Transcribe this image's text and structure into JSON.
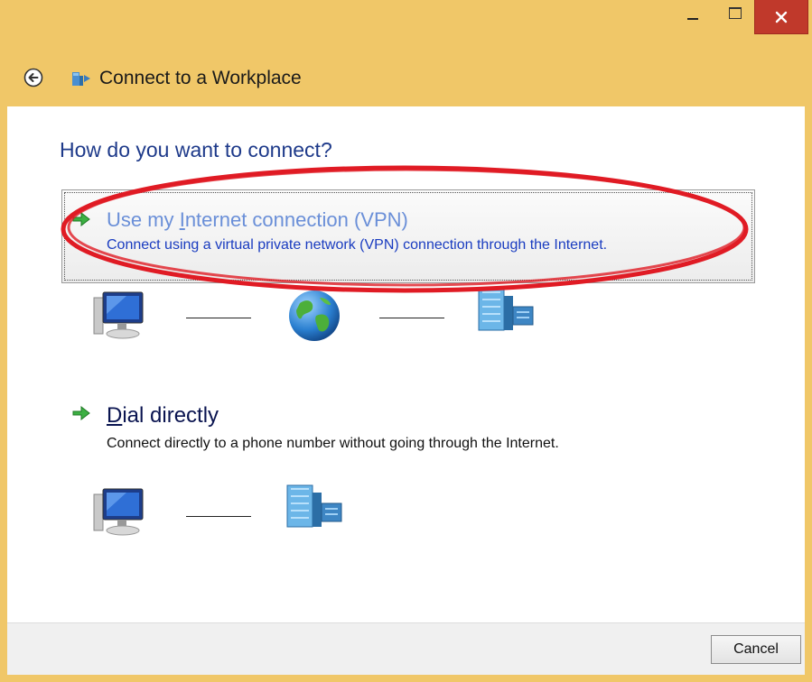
{
  "window": {
    "title": "Connect to a Workplace",
    "accent_color": "#f0c768",
    "close_color": "#c0392b"
  },
  "titlebar_icons": [
    "minimize-icon",
    "maximize-icon",
    "close-icon"
  ],
  "nav": {
    "back_icon": "back-arrow-icon",
    "app_icon": "network-workplace-icon",
    "title": "Connect to a Workplace"
  },
  "main": {
    "heading": "How do you want to connect?",
    "options": [
      {
        "title_prefix": "Use my ",
        "title_accel": "I",
        "title_suffix": "nternet connection (VPN)",
        "description": "Connect using a virtual private network (VPN) connection through the Internet.",
        "icon": "green-arrow-icon",
        "diagram": [
          "computer-icon",
          "globe-icon",
          "workplace-building-icon"
        ]
      },
      {
        "title_prefix": "",
        "title_accel": "D",
        "title_suffix": "ial directly",
        "description": "Connect directly to a phone number without going through the Internet.",
        "icon": "green-arrow-icon",
        "diagram": [
          "computer-icon",
          "workplace-building-icon"
        ]
      }
    ],
    "annotation_color": "#e01b24"
  },
  "footer": {
    "cancel_label": "Cancel"
  }
}
